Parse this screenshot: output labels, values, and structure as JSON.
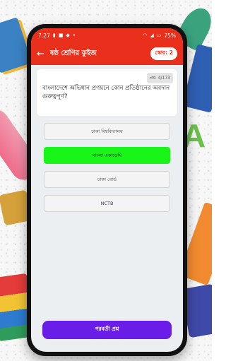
{
  "status_bar": {
    "time": "7:27",
    "battery": "75%",
    "left_icons": [
      "signal-icon",
      "notification-icon",
      "shield-icon",
      "dot-icon"
    ],
    "right_icons": [
      "wifi-icon",
      "signal-icon",
      "battery-icon"
    ]
  },
  "app_bar": {
    "title": "ষষ্ঠ শ্রেণির কুইজ",
    "score": "স্কোর: 2"
  },
  "question": {
    "counter": "প্রশ্ন: 4/173",
    "text": "বাংলাদেশে অভিধান প্রণয়নে কোন প্রতিষ্ঠানের অবদান গুরুত্বপূর্ণ?"
  },
  "options": [
    {
      "label": "ঢাকা বিশ্ববিদ্যালয়",
      "state": "normal"
    },
    {
      "label": "বাংলা একাডেমি",
      "state": "correct"
    },
    {
      "label": "ঢাকা বোর্ড",
      "state": "normal"
    },
    {
      "label": "NCTB",
      "state": "normal"
    }
  ],
  "next_button": "পরবর্তী প্রশ্ন",
  "colors": {
    "primary": "#e8301c",
    "correct": "#19f519",
    "button": "#6a1de6"
  }
}
